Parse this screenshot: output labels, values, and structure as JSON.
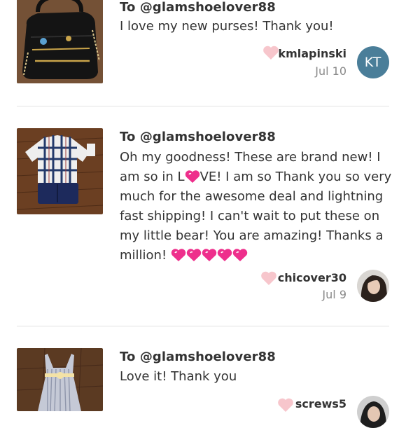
{
  "reviews": [
    {
      "to": "To @glamshoelover88",
      "message": "I love my new purses! Thank you!",
      "username": "kmlapinski",
      "date": "Jul 10",
      "avatar_initials": "KT",
      "product_image": "black-handbag"
    },
    {
      "to": "To @glamshoelover88",
      "message_part1": "Oh my goodness! These are brand new! I am so in L",
      "message_part2": "VE! I am so Thank you so very much for the awesome deal and lightning fast shipping! I can't wait to put these on my little bear! You are amazing! Thanks a million!",
      "username": "chicover30",
      "date": "Jul 9",
      "avatar_initials": "",
      "product_image": "plaid-shirt-and-navy-shorts"
    },
    {
      "to": "To @glamshoelover88",
      "message": "Love it! Thank you",
      "username": "screws5",
      "date": "",
      "avatar_initials": "",
      "product_image": "striped-dress"
    }
  ],
  "colors": {
    "like_heart": "#f7c6cc",
    "emoji_heart": "#ee2f8c",
    "avatar_kt": "#4a7e99",
    "wood_floor": "#6b3f22"
  },
  "icons": {
    "like": "heart-icon",
    "emoji": "sparkling-heart-emoji"
  }
}
